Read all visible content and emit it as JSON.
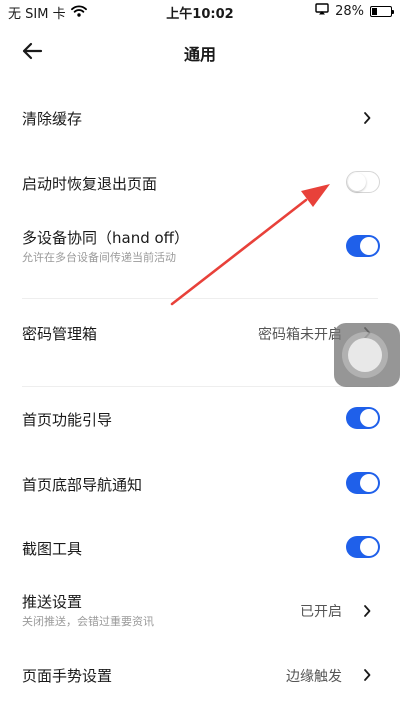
{
  "status_bar": {
    "carrier": "无 SIM 卡",
    "time": "上午10:02",
    "battery": "28%",
    "battery_level": 0.28
  },
  "nav": {
    "title": "通用"
  },
  "settings": {
    "clear_cache": {
      "label": "清除缓存"
    },
    "restore_pages": {
      "label": "启动时恢复退出页面",
      "on": false
    },
    "handoff": {
      "label": "多设备协同（hand off）",
      "sub": "允许在多台设备间传递当前活动",
      "on": true
    },
    "password_box": {
      "label": "密码管理箱",
      "value": "密码箱未开启"
    },
    "home_guide": {
      "label": "首页功能引导",
      "on": true
    },
    "bottom_nav_notice": {
      "label": "首页底部导航通知",
      "on": true
    },
    "screenshot_tool": {
      "label": "截图工具",
      "on": true
    },
    "push": {
      "label": "推送设置",
      "sub": "关闭推送，会错过重要资讯",
      "value": "已开启"
    },
    "gesture": {
      "label": "页面手势设置",
      "value": "边缘触发"
    }
  },
  "colors": {
    "toggle_on": "#1f60ea",
    "annotation_arrow": "#e8413a"
  }
}
